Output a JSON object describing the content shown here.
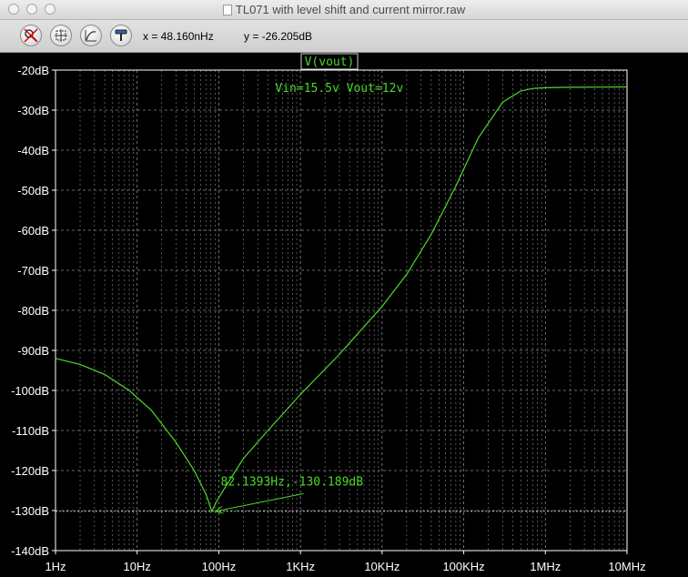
{
  "window": {
    "title": "TL071 with level shift and current mirror.raw"
  },
  "toolbar": {
    "tools": [
      {
        "icon": "zoom-cancel-icon"
      },
      {
        "icon": "autorange-icon"
      },
      {
        "icon": "cursor-annotate-icon"
      },
      {
        "icon": "probe-icon"
      }
    ],
    "readout_x": "x = 48.160nHz",
    "readout_y": "y = -26.205dB"
  },
  "colors": {
    "background": "#000000",
    "trace": "#4cd92a",
    "grid": "#8a8a8a",
    "axis_text": "#ffffff"
  },
  "chart_data": {
    "type": "line",
    "title": "V(vout)",
    "xscale": "log",
    "xlim": [
      1,
      10000000
    ],
    "ylim": [
      -140,
      -20
    ],
    "grid": true,
    "x_ticks": [
      {
        "value": 1,
        "label": "1Hz"
      },
      {
        "value": 10,
        "label": "10Hz"
      },
      {
        "value": 100,
        "label": "100Hz"
      },
      {
        "value": 1000,
        "label": "1KHz"
      },
      {
        "value": 10000,
        "label": "10KHz"
      },
      {
        "value": 100000,
        "label": "100KHz"
      },
      {
        "value": 1000000,
        "label": "1MHz"
      },
      {
        "value": 10000000,
        "label": "10MHz"
      }
    ],
    "y_ticks": [
      {
        "value": -20,
        "label": "-20dB"
      },
      {
        "value": -30,
        "label": "-30dB"
      },
      {
        "value": -40,
        "label": "-40dB"
      },
      {
        "value": -50,
        "label": "-50dB"
      },
      {
        "value": -60,
        "label": "-60dB"
      },
      {
        "value": -70,
        "label": "-70dB"
      },
      {
        "value": -80,
        "label": "-80dB"
      },
      {
        "value": -90,
        "label": "-90dB"
      },
      {
        "value": -100,
        "label": "-100dB"
      },
      {
        "value": -110,
        "label": "-110dB"
      },
      {
        "value": -120,
        "label": "-120dB"
      },
      {
        "value": -130,
        "label": "-130dB"
      },
      {
        "value": -140,
        "label": "-140dB"
      }
    ],
    "series": [
      {
        "name": "V(vout)",
        "x": [
          1,
          2,
          4,
          8,
          15,
          30,
          50,
          70,
          82.14,
          95,
          130,
          200,
          400,
          1000,
          3000,
          10000,
          20000,
          40000,
          80000,
          150000,
          300000,
          500000,
          700000,
          1000000,
          2000000,
          5000000,
          10000000
        ],
        "y": [
          -92,
          -93.5,
          -96,
          -100,
          -105,
          -113,
          -120,
          -126,
          -130.19,
          -127.5,
          -123,
          -117,
          -110,
          -101,
          -91,
          -79,
          -71,
          -61,
          -49,
          -37,
          -28,
          -25.2,
          -24.6,
          -24.4,
          -24.3,
          -24.25,
          -24.2
        ]
      }
    ],
    "annotations": [
      {
        "text": "Vin=15.5v Vout=12v",
        "x": 5000,
        "y": -25
      },
      {
        "text": "82.1393Hz,-130.189dB",
        "x": 120,
        "y": -124.4,
        "arrow_to": {
          "x": 82.14,
          "y": -130.19
        }
      }
    ],
    "cursor_line": {
      "y": -130.19
    }
  }
}
